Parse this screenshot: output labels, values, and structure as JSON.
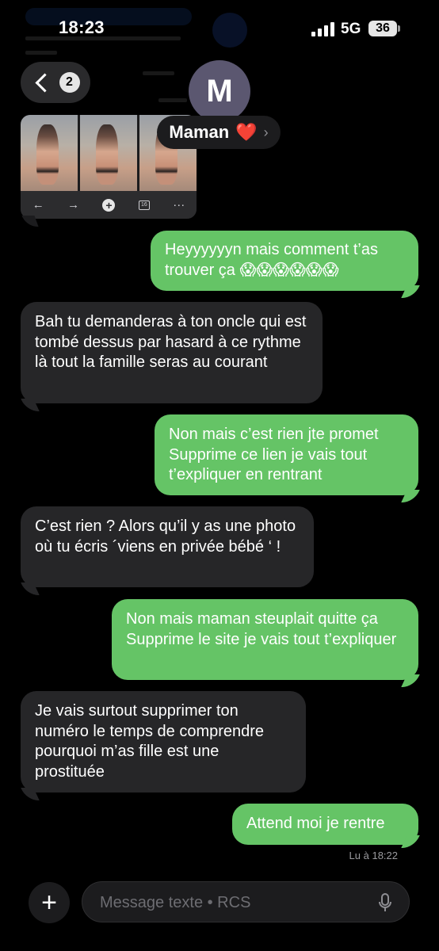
{
  "status_bar": {
    "time": "18:23",
    "network": "5G",
    "battery": "36"
  },
  "header": {
    "back_count": "2",
    "avatar_letter": "M",
    "contact_name": "Maman",
    "contact_emoji": "❤️",
    "chevron": "›"
  },
  "attachment": {
    "tab_count": "16"
  },
  "messages": [
    {
      "side": "sent",
      "text": "Heyyyyyyn mais comment t’as trouver ça 😱😱😱😱😱😱"
    },
    {
      "side": "received",
      "text": "Bah tu demanderas à ton oncle qui est tombé dessus par hasard à ce rythme là tout la famille seras au courant"
    },
    {
      "side": "sent",
      "text": "Non mais c’est rien jte promet Supprime ce lien je vais tout t’expliquer en rentrant"
    },
    {
      "side": "received",
      "text": "C’est rien ? Alors qu’il y as une photo où tu écris ´viens en privée bébé ‘ !"
    },
    {
      "side": "sent",
      "text": "Non mais maman steuplait quitte ça Supprime le site je vais tout t’expliquer"
    },
    {
      "side": "received",
      "text": "Je vais surtout supprimer ton numéro le temps de comprendre pourquoi m’as fille est une prostituée"
    },
    {
      "side": "sent",
      "text": "Attend moi je rentre"
    }
  ],
  "read_receipt": "Lu à 18:22",
  "composer": {
    "placeholder": "Message texte • RCS"
  },
  "colors": {
    "sent_bubble": "#65c466",
    "received_bubble": "#262628",
    "background": "#000000"
  }
}
